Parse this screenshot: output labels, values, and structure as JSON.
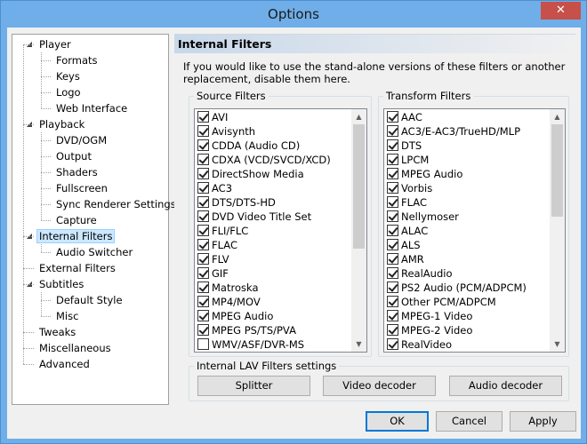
{
  "window": {
    "title": "Options",
    "close_glyph": "✕"
  },
  "tree": {
    "expand_glyph": "◢",
    "items": [
      {
        "label": "Player",
        "level": 0,
        "expandable": true
      },
      {
        "label": "Formats",
        "level": 1
      },
      {
        "label": "Keys",
        "level": 1
      },
      {
        "label": "Logo",
        "level": 1
      },
      {
        "label": "Web Interface",
        "level": 1
      },
      {
        "label": "Playback",
        "level": 0,
        "expandable": true
      },
      {
        "label": "DVD/OGM",
        "level": 1
      },
      {
        "label": "Output",
        "level": 1
      },
      {
        "label": "Shaders",
        "level": 1
      },
      {
        "label": "Fullscreen",
        "level": 1
      },
      {
        "label": "Sync Renderer Settings",
        "level": 1
      },
      {
        "label": "Capture",
        "level": 1
      },
      {
        "label": "Internal Filters",
        "level": 0,
        "expandable": true,
        "selected": true
      },
      {
        "label": "Audio Switcher",
        "level": 1
      },
      {
        "label": "External Filters",
        "level": 0
      },
      {
        "label": "Subtitles",
        "level": 0,
        "expandable": true
      },
      {
        "label": "Default Style",
        "level": 1
      },
      {
        "label": "Misc",
        "level": 1
      },
      {
        "label": "Tweaks",
        "level": 0
      },
      {
        "label": "Miscellaneous",
        "level": 0
      },
      {
        "label": "Advanced",
        "level": 0
      }
    ]
  },
  "page": {
    "title": "Internal Filters",
    "description": "If you would like to use the stand-alone versions of these filters or another replacement, disable them here."
  },
  "source_filters": {
    "label": "Source Filters",
    "items": [
      {
        "label": "AVI",
        "checked": true
      },
      {
        "label": "Avisynth",
        "checked": true
      },
      {
        "label": "CDDA (Audio CD)",
        "checked": true
      },
      {
        "label": "CDXA (VCD/SVCD/XCD)",
        "checked": true
      },
      {
        "label": "DirectShow Media",
        "checked": true
      },
      {
        "label": "AC3",
        "checked": true
      },
      {
        "label": "DTS/DTS-HD",
        "checked": true
      },
      {
        "label": "DVD Video Title Set",
        "checked": true
      },
      {
        "label": "FLI/FLC",
        "checked": true
      },
      {
        "label": "FLAC",
        "checked": true
      },
      {
        "label": "FLV",
        "checked": true
      },
      {
        "label": "GIF",
        "checked": true
      },
      {
        "label": "Matroska",
        "checked": true
      },
      {
        "label": "MP4/MOV",
        "checked": true
      },
      {
        "label": "MPEG Audio",
        "checked": true
      },
      {
        "label": "MPEG PS/TS/PVA",
        "checked": true
      },
      {
        "label": "WMV/ASF/DVR-MS",
        "checked": false
      }
    ]
  },
  "transform_filters": {
    "label": "Transform Filters",
    "items": [
      {
        "label": "AAC",
        "checked": true
      },
      {
        "label": "AC3/E-AC3/TrueHD/MLP",
        "checked": true
      },
      {
        "label": "DTS",
        "checked": true
      },
      {
        "label": "LPCM",
        "checked": true
      },
      {
        "label": "MPEG Audio",
        "checked": true
      },
      {
        "label": "Vorbis",
        "checked": true
      },
      {
        "label": "FLAC",
        "checked": true
      },
      {
        "label": "Nellymoser",
        "checked": true
      },
      {
        "label": "ALAC",
        "checked": true
      },
      {
        "label": "ALS",
        "checked": true
      },
      {
        "label": "AMR",
        "checked": true
      },
      {
        "label": "RealAudio",
        "checked": true
      },
      {
        "label": "PS2 Audio (PCM/ADPCM)",
        "checked": true
      },
      {
        "label": "Other PCM/ADPCM",
        "checked": true
      },
      {
        "label": "MPEG-1 Video",
        "checked": true
      },
      {
        "label": "MPEG-2 Video",
        "checked": true
      },
      {
        "label": "RealVideo",
        "checked": true
      }
    ]
  },
  "scroll_glyphs": {
    "up": "▲",
    "down": "▼"
  },
  "lav": {
    "label": "Internal LAV Filters settings",
    "splitter": "Splitter",
    "video_decoder": "Video decoder",
    "audio_decoder": "Audio decoder"
  },
  "footer": {
    "ok": "OK",
    "cancel": "Cancel",
    "apply": "Apply"
  }
}
